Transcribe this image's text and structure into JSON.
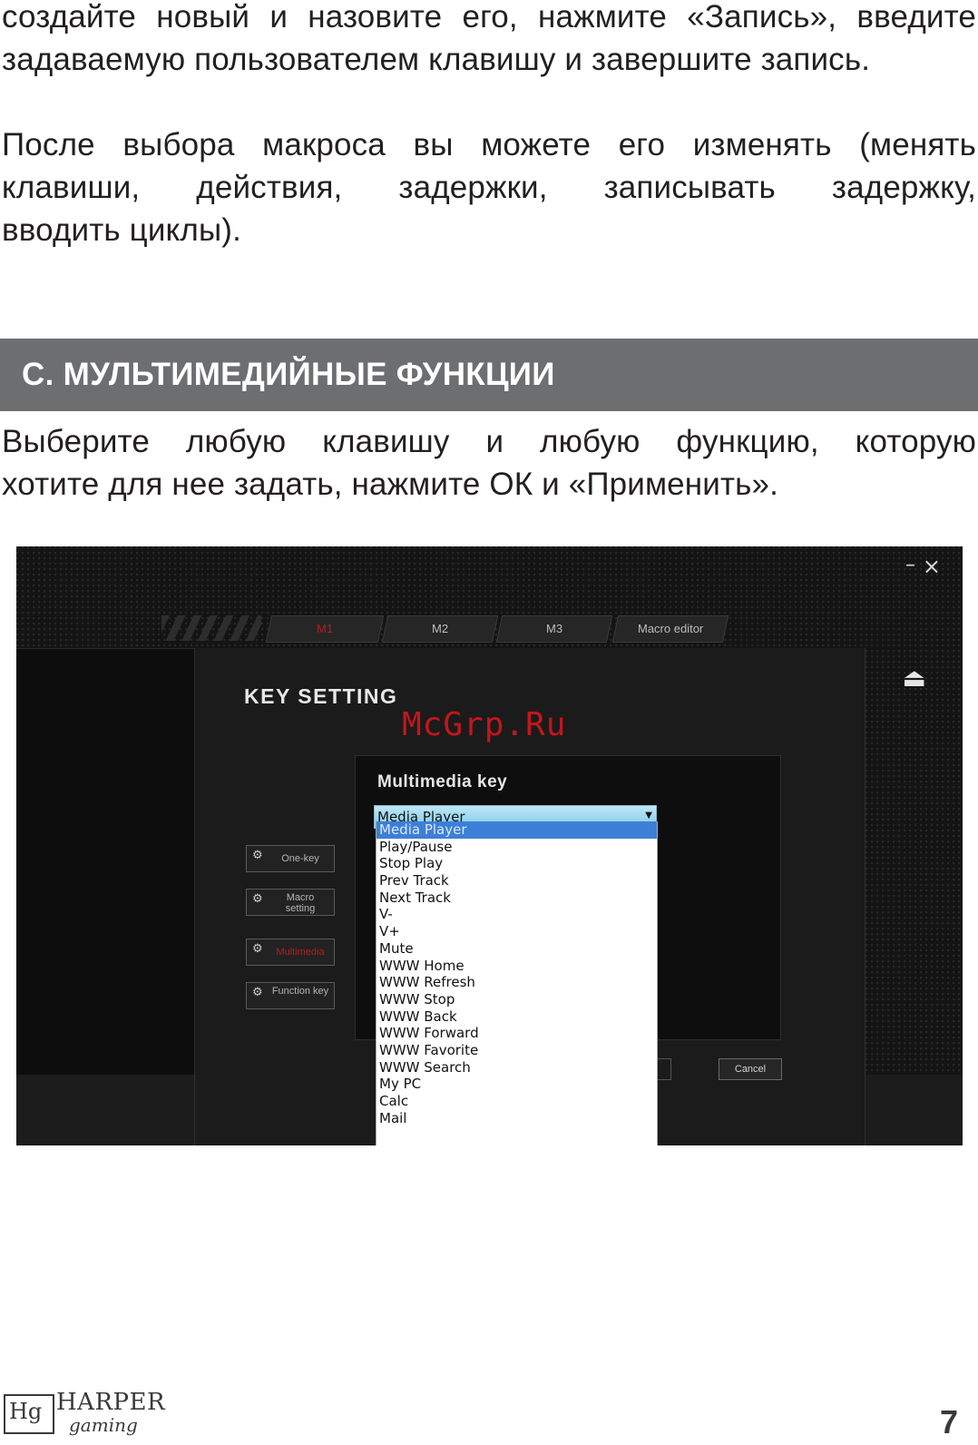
{
  "paragraphs": {
    "p1": [
      "создайте новый и назовите его, нажмите «Запись», введите",
      "задаваемую пользователем клавишу и завершите запись."
    ],
    "p2": [
      "После выбора макроса вы можете его изменять (менять",
      "клавиши, действия, задержки, записывать задержку,",
      "вводить циклы)."
    ],
    "p3": [
      "Выберите любую клавишу и любую функцию, которую",
      "хотите для нее задать, нажмите ОК и «Применить»."
    ]
  },
  "section": {
    "title": "С. МУЛЬТИМЕДИЙНЫЕ ФУНКЦИИ"
  },
  "screenshot": {
    "window_controls": {
      "minimize": "–",
      "close": "×"
    },
    "tabs": [
      "M1",
      "M2",
      "M3",
      "Macro editor"
    ],
    "active_tab": "M1",
    "dialog_title": "KEY SETTING",
    "watermark": "McGrp.Ru",
    "side_buttons": [
      "One-key",
      "Macro setting",
      "Multimedia",
      "Function key"
    ],
    "panel_title": "Multimedia key",
    "select_value": "Media Player",
    "options": [
      "Media Player",
      "Play/Pause",
      "Stop Play",
      "Prev Track",
      "Next Track",
      "V-",
      "V+",
      "Mute",
      "WWW Home",
      "WWW Refresh",
      "WWW Stop",
      "WWW Back",
      "WWW Forward",
      "WWW Favorite",
      "WWW Search",
      "My PC",
      "Calc",
      "Mail"
    ],
    "selected_option": "Media Player",
    "cancel_label": "Cancel",
    "icons": [
      "eject-icon",
      "gear-icon",
      "device-icon",
      "headset-icon"
    ]
  },
  "footer": {
    "logo_text": "HARPER",
    "logo_sub": "gaming",
    "logo_mark": "Hg",
    "page_number": "7"
  }
}
